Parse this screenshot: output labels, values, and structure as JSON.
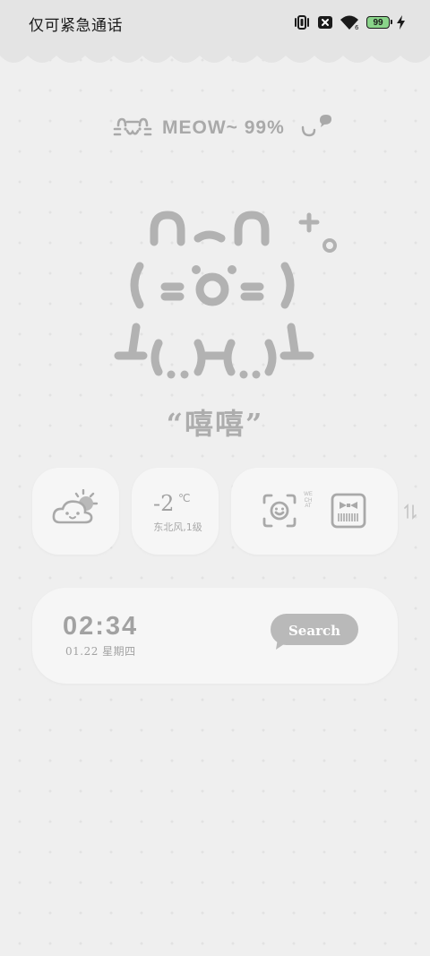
{
  "status_bar": {
    "carrier_text": "仅可紧急通话",
    "battery_level": "99",
    "icons": [
      "vibrate-icon",
      "no-sim-icon",
      "wifi-icon",
      "battery-icon",
      "charging-icon"
    ]
  },
  "meow": {
    "text": "MEOW~ 99%"
  },
  "quote": {
    "text": "“嘻嘻”"
  },
  "weather": {
    "icon": "partly-cloudy-icon",
    "temperature": "-2",
    "unit": "℃",
    "wind": "东北风,1级"
  },
  "apps": {
    "scan_icon": "scan-smile-icon",
    "wechat_label": "WECHAT",
    "pay_icon": "pay-code-icon"
  },
  "clock": {
    "time": "02:34",
    "date": "01.22 星期四"
  },
  "search": {
    "label": "Search"
  },
  "colors": {
    "background": "#efefef",
    "card": "#f6f6f6",
    "accent_gray": "#a9a9a9",
    "search_bubble": "#b9b9b9",
    "battery_fill": "#8ad48a"
  }
}
